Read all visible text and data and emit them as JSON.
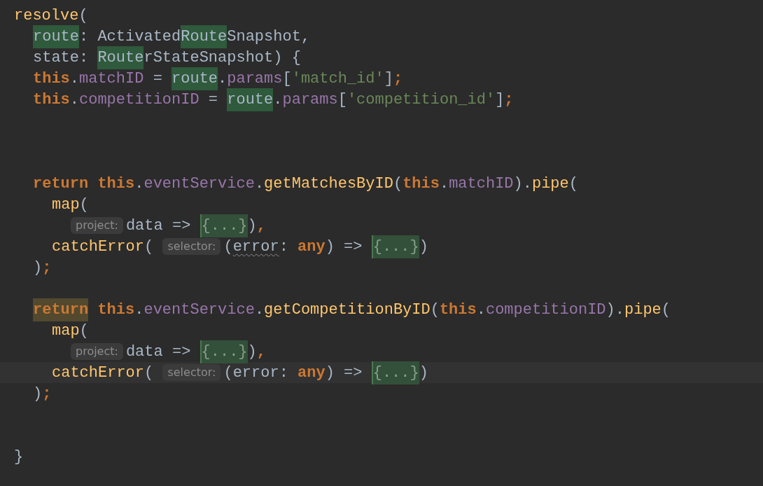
{
  "editor": {
    "lines": [
      {
        "kind": "code",
        "tokens": [
          {
            "text": "resolve",
            "kind": "method"
          },
          {
            "text": "(",
            "kind": "plain"
          }
        ],
        "children": [
          {
            "kind": "code",
            "tokens": [
              {
                "text": "route",
                "kind": "usage"
              },
              {
                "text": ": Activated",
                "kind": "plain"
              },
              {
                "text": "Route",
                "kind": "usage"
              },
              {
                "text": "Snapshot,",
                "kind": "plain"
              }
            ]
          },
          {
            "kind": "code",
            "tokens": [
              {
                "text": "state: ",
                "kind": "plain"
              },
              {
                "text": "Route",
                "kind": "usage"
              },
              {
                "text": "rStateSnapshot) {",
                "kind": "plain"
              }
            ]
          },
          {
            "kind": "code",
            "tokens": [
              {
                "text": "this",
                "kind": "keyword"
              },
              {
                "text": ".",
                "kind": "plain"
              },
              {
                "text": "matchID",
                "kind": "field"
              },
              {
                "text": " = ",
                "kind": "plain"
              },
              {
                "text": "route",
                "kind": "usage"
              },
              {
                "text": ".",
                "kind": "plain"
              },
              {
                "text": "params",
                "kind": "field"
              },
              {
                "text": "[",
                "kind": "plain"
              },
              {
                "text": "'match_id'",
                "kind": "string"
              },
              {
                "text": "]",
                "kind": "plain"
              },
              {
                "text": ";",
                "kind": "keyword"
              }
            ]
          },
          {
            "kind": "code",
            "tokens": [
              {
                "text": "this",
                "kind": "keyword"
              },
              {
                "text": ".",
                "kind": "plain"
              },
              {
                "text": "competitionID",
                "kind": "field"
              },
              {
                "text": " = ",
                "kind": "plain"
              },
              {
                "text": "route",
                "kind": "usage"
              },
              {
                "text": ".",
                "kind": "plain"
              },
              {
                "text": "params",
                "kind": "field"
              },
              {
                "text": "[",
                "kind": "plain"
              },
              {
                "text": "'competition_id'",
                "kind": "string"
              },
              {
                "text": "]",
                "kind": "plain"
              },
              {
                "text": ";",
                "kind": "keyword"
              }
            ]
          },
          {
            "kind": "blank"
          },
          {
            "kind": "blank"
          },
          {
            "kind": "blank"
          },
          {
            "kind": "code",
            "tokens": [
              {
                "text": "return",
                "kind": "keyword"
              },
              {
                "text": " this",
                "kind": "keyword"
              },
              {
                "text": ".",
                "kind": "plain"
              },
              {
                "text": "eventService",
                "kind": "field"
              },
              {
                "text": ".",
                "kind": "plain"
              },
              {
                "text": "getMatchesByID",
                "kind": "method"
              },
              {
                "text": "(",
                "kind": "plain"
              },
              {
                "text": "this",
                "kind": "keyword"
              },
              {
                "text": ".",
                "kind": "plain"
              },
              {
                "text": "matchID",
                "kind": "field"
              },
              {
                "text": ").",
                "kind": "plain"
              },
              {
                "text": "pipe",
                "kind": "method"
              },
              {
                "text": "(",
                "kind": "plain"
              }
            ],
            "children": [
              {
                "kind": "code",
                "tokens": [
                  {
                    "text": "map",
                    "kind": "method"
                  },
                  {
                    "text": "(",
                    "kind": "plain"
                  }
                ],
                "children": [
                  {
                    "kind": "code",
                    "tokens": [
                      {
                        "text": "project:",
                        "kind": "hint"
                      },
                      {
                        "text": "data => ",
                        "kind": "plain"
                      },
                      {
                        "text": "{...}",
                        "kind": "fold"
                      },
                      {
                        "text": ")",
                        "kind": "plain"
                      },
                      {
                        "text": ",",
                        "kind": "keyword"
                      }
                    ]
                  }
                ]
              },
              {
                "kind": "code",
                "tokens": [
                  {
                    "text": "catchError",
                    "kind": "method"
                  },
                  {
                    "text": "( ",
                    "kind": "plain"
                  },
                  {
                    "text": "selector:",
                    "kind": "hint"
                  },
                  {
                    "text": "(",
                    "kind": "plain"
                  },
                  {
                    "text": "error",
                    "kind": "warned"
                  },
                  {
                    "text": ": ",
                    "kind": "plain"
                  },
                  {
                    "text": "any",
                    "kind": "keyword"
                  },
                  {
                    "text": ") => ",
                    "kind": "plain"
                  },
                  {
                    "text": "{...}",
                    "kind": "fold"
                  },
                  {
                    "text": ")",
                    "kind": "plain"
                  }
                ]
              }
            ]
          },
          {
            "kind": "code",
            "tokens": [
              {
                "text": ")",
                "kind": "plain"
              },
              {
                "text": ";",
                "kind": "keyword"
              }
            ]
          },
          {
            "kind": "blank"
          },
          {
            "kind": "code",
            "tokens": [
              {
                "text": "return",
                "kind": "caret"
              },
              {
                "text": " this",
                "kind": "keyword"
              },
              {
                "text": ".",
                "kind": "plain"
              },
              {
                "text": "eventService",
                "kind": "field"
              },
              {
                "text": ".",
                "kind": "plain"
              },
              {
                "text": "getCompetitionByID",
                "kind": "method"
              },
              {
                "text": "(",
                "kind": "plain"
              },
              {
                "text": "this",
                "kind": "keyword"
              },
              {
                "text": ".",
                "kind": "plain"
              },
              {
                "text": "competitionID",
                "kind": "field"
              },
              {
                "text": ").",
                "kind": "plain"
              },
              {
                "text": "pipe",
                "kind": "method"
              },
              {
                "text": "(",
                "kind": "plain"
              }
            ],
            "children": [
              {
                "kind": "code",
                "tokens": [
                  {
                    "text": "map",
                    "kind": "method"
                  },
                  {
                    "text": "(",
                    "kind": "plain"
                  }
                ],
                "children": [
                  {
                    "kind": "code",
                    "tokens": [
                      {
                        "text": "project:",
                        "kind": "hint"
                      },
                      {
                        "text": "data => ",
                        "kind": "plain"
                      },
                      {
                        "text": "{...}",
                        "kind": "fold"
                      },
                      {
                        "text": ")",
                        "kind": "plain"
                      },
                      {
                        "text": ",",
                        "kind": "keyword"
                      }
                    ]
                  }
                ]
              },
              {
                "kind": "current",
                "tokens": [
                  {
                    "text": "catchError",
                    "kind": "method"
                  },
                  {
                    "text": "( ",
                    "kind": "plain"
                  },
                  {
                    "text": "selector:",
                    "kind": "hint"
                  },
                  {
                    "text": "(error: ",
                    "kind": "plain"
                  },
                  {
                    "text": "any",
                    "kind": "keyword"
                  },
                  {
                    "text": ") => ",
                    "kind": "plain"
                  },
                  {
                    "text": "{...}",
                    "kind": "fold"
                  },
                  {
                    "text": ")",
                    "kind": "plain"
                  }
                ]
              }
            ]
          },
          {
            "kind": "code",
            "tokens": [
              {
                "text": ")",
                "kind": "plain"
              },
              {
                "text": ";",
                "kind": "keyword"
              }
            ]
          },
          {
            "kind": "blank"
          },
          {
            "kind": "blank"
          }
        ]
      },
      {
        "kind": "code",
        "tokens": [
          {
            "text": "}",
            "kind": "plain"
          }
        ]
      }
    ]
  }
}
